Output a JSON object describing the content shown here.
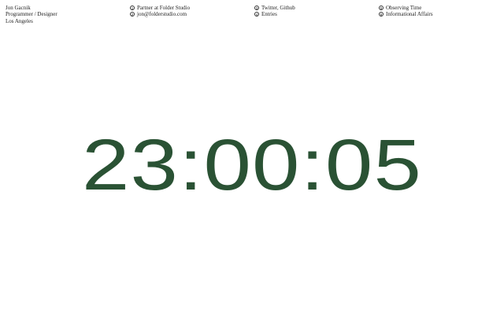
{
  "profile": {
    "name": "Jon Gacnik",
    "role": "Programmer / Designer",
    "location": "Los Angeles"
  },
  "nav": {
    "items": [
      {
        "number": "1",
        "label": "Partner at Folder Studio"
      },
      {
        "number": "2",
        "label": "jon@folderstudio.com"
      },
      {
        "number": "3",
        "label": "Twitter, Github"
      },
      {
        "number": "4",
        "label": "Entries"
      },
      {
        "number": "5",
        "label": "Observing Time"
      },
      {
        "number": "6",
        "label": "Informational Affairs"
      }
    ]
  },
  "clock": {
    "time": "23:00:05",
    "color": "#2a5234"
  }
}
